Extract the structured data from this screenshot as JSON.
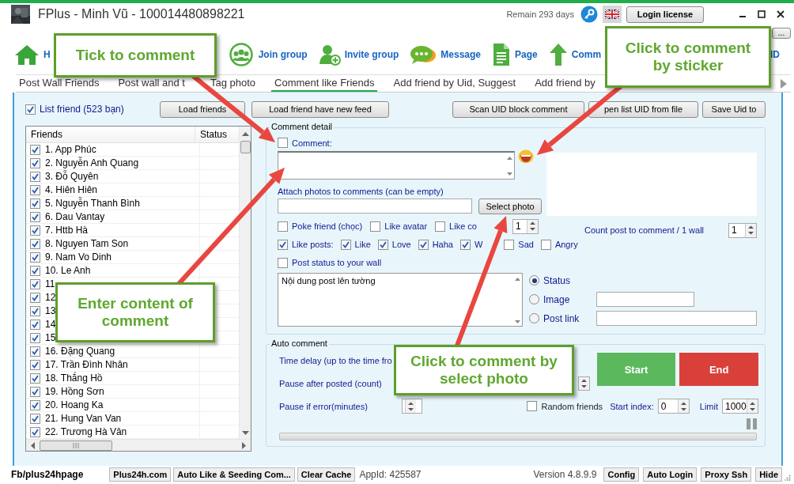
{
  "window": {
    "title": "FPlus - Minh Vũ - 100014480898221",
    "remaining": "Remain 293 days",
    "login_button": "Login license"
  },
  "more_button": "...",
  "toolbar": [
    {
      "kind": "home",
      "label": "H"
    },
    {
      "kind": "group",
      "label": "Join group"
    },
    {
      "kind": "invite",
      "label": "Invite group"
    },
    {
      "kind": "message",
      "label": "Message"
    },
    {
      "kind": "page",
      "label": "Page"
    },
    {
      "kind": "up",
      "label": "Comm"
    },
    {
      "kind": "text",
      "label": "ID"
    }
  ],
  "tabs": [
    {
      "label": "Post Wall Friends",
      "selected": false
    },
    {
      "label": "Post wall and t",
      "selected": false
    },
    {
      "label": "Tag photo",
      "selected": false
    },
    {
      "label": "Comment like Friends",
      "selected": true
    },
    {
      "label": "Add friend by Uid, Suggest",
      "selected": false
    },
    {
      "label": "Add friend by",
      "selected": false
    }
  ],
  "friends": {
    "list_friend": {
      "label": "List friend (523 bạn)",
      "checked": true
    },
    "load_button": "Load friends",
    "columns": [
      "Friends",
      "Status"
    ],
    "rows": [
      {
        "name": "1. App Phúc",
        "checked": true
      },
      {
        "name": "2. Nguyễn Anh Quang",
        "checked": true
      },
      {
        "name": "3. Đỗ Quyên",
        "checked": true
      },
      {
        "name": "4. Hiên Hiên",
        "checked": true
      },
      {
        "name": "5. Nguyễn Thanh Bình",
        "checked": true
      },
      {
        "name": "6. Dau Vantay",
        "checked": true
      },
      {
        "name": "7. Httb Hà",
        "checked": true
      },
      {
        "name": "8. Nguyen Tam Son",
        "checked": true
      },
      {
        "name": "9. Nam Vo Dinh",
        "checked": true
      },
      {
        "name": "10. Le Anh",
        "checked": true
      },
      {
        "name": "11",
        "checked": true
      },
      {
        "name": "12",
        "checked": true
      },
      {
        "name": "13",
        "checked": true
      },
      {
        "name": "14",
        "checked": true
      },
      {
        "name": "15",
        "checked": true
      },
      {
        "name": "16. Đặng Quang",
        "checked": true
      },
      {
        "name": "17. Trần Đình Nhân",
        "checked": true
      },
      {
        "name": "18. Thắng Hồ",
        "checked": true
      },
      {
        "name": "19. Hồng Sơn",
        "checked": true
      },
      {
        "name": "20. Hoang Ka",
        "checked": true
      },
      {
        "name": "21. Hung Van Van",
        "checked": true
      },
      {
        "name": "22. Trương Hà Vân",
        "checked": true
      }
    ]
  },
  "actions": {
    "left": "Load friend have new feed",
    "right": [
      "Scan UID block comment",
      "pen list UID from file",
      "Save Uid to"
    ]
  },
  "comment_detail": {
    "title": "Comment detail",
    "comment": {
      "label": "Comment:",
      "checked": false
    },
    "attach_label": "Attach photos to comments (can be empty)",
    "select_photo": "Select photo",
    "options": [
      {
        "label": "Poke friend (chọc)",
        "checked": false
      },
      {
        "label": "Like avatar",
        "checked": false
      },
      {
        "label": "Like co",
        "checked": false
      }
    ],
    "like_comment_count": "1",
    "count_label": "Count post to comment / 1 wall",
    "count_value": "1",
    "reactions": [
      {
        "label": "Like posts:",
        "checked": true
      },
      {
        "label": "Like",
        "checked": true
      },
      {
        "label": "Love",
        "checked": true
      },
      {
        "label": "Haha",
        "checked": true
      },
      {
        "label": "W",
        "checked": true
      },
      {
        "label": "Sad",
        "checked": false
      },
      {
        "label": "Angry",
        "checked": false
      }
    ],
    "post_status": {
      "label": "Post status to your wall",
      "checked": false
    },
    "status_text": "Nội dung post lên tường",
    "post_types": [
      {
        "label": "Status",
        "selected": true,
        "kind": "none"
      },
      {
        "label": "Image",
        "selected": false,
        "kind": "short"
      },
      {
        "label": "Post link",
        "selected": false,
        "kind": "wide"
      }
    ]
  },
  "auto_comment": {
    "title": "Auto comment",
    "time_delay": "Time delay (up to the time fro",
    "pause_after": "Pause after posted (count)",
    "pause_error": "Pause if error(minutes)",
    "start": "Start",
    "end": "End",
    "random": {
      "label": "Random friends",
      "checked": false
    },
    "start_index_label": "Start index:",
    "start_index": "0",
    "limit_label": "Limit",
    "limit": "1000",
    "progress": {
      "level": 0
    }
  },
  "status_bar": {
    "page": "Fb/plus24hpage",
    "buttons_left": [
      "Plus24h.com",
      "Auto Like & Seeding Com...",
      "Clear Cache"
    ],
    "app_id": "AppId: 425587",
    "version": "Version 4.8.9.9",
    "buttons_right": [
      "Config",
      "Auto Login",
      "Proxy Ssh",
      "Hide"
    ]
  },
  "callouts": [
    {
      "text": "Tick to comment"
    },
    {
      "text": "Click to comment by sticker"
    },
    {
      "text": "Enter content of comment"
    },
    {
      "text": "Click to comment by select photo"
    }
  ]
}
